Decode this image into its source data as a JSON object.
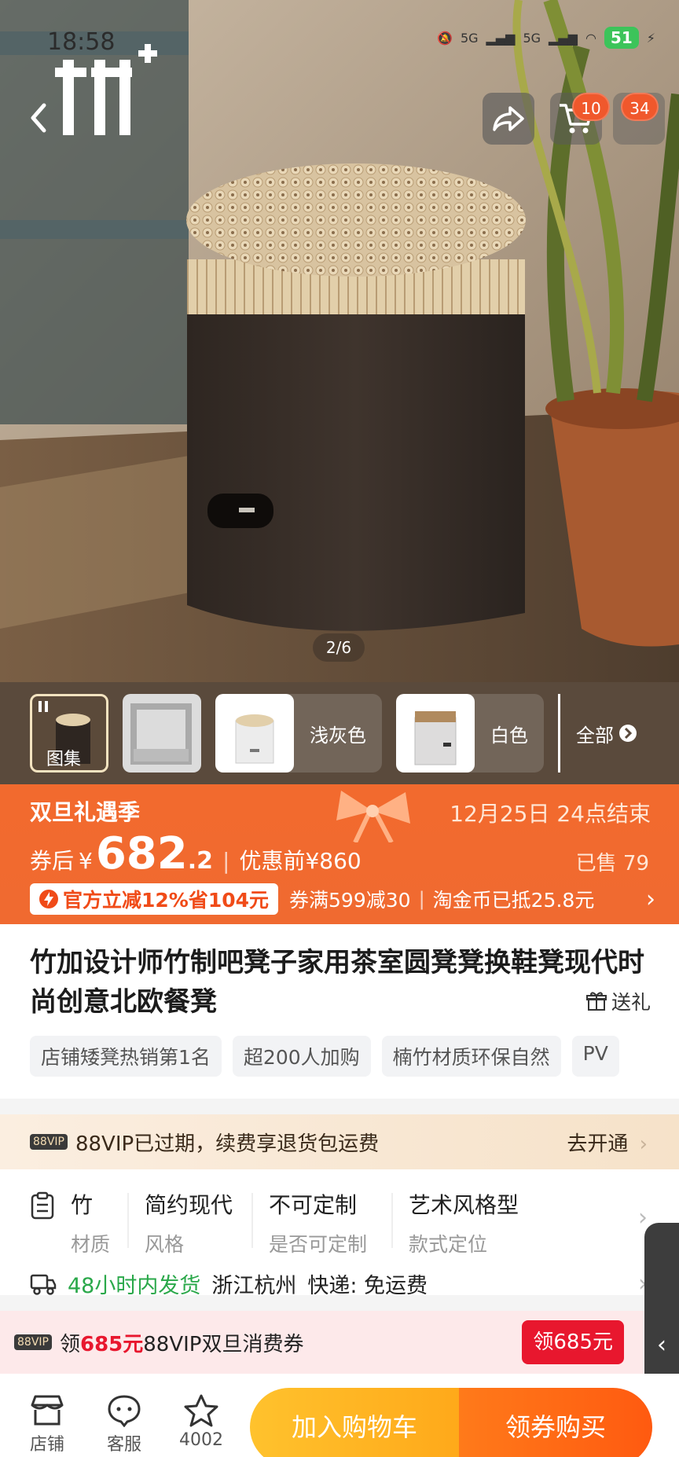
{
  "status_bar": {
    "time": "18:58",
    "network_1": "5G",
    "network_2": "5G",
    "battery": "51"
  },
  "header": {
    "cart_badge": "10",
    "more_badge": "34"
  },
  "hero": {
    "page_indicator": "2/6"
  },
  "thumbnails": {
    "gallery_label": "图集",
    "color_1": "浅灰色",
    "color_2": "白色",
    "all_label": "全部"
  },
  "promo": {
    "event_title": "双旦礼遇季",
    "end_time": "12月25日 24点结束",
    "price_prefix": "券后",
    "currency": "¥",
    "price_main": "682",
    "price_decimal": ".2",
    "price_before": "优惠前¥860",
    "sold": "已售 79",
    "official_discount": "官方立减12%省104元",
    "coupon_rule": "券满599减30",
    "coin_info": "淘金币已抵25.8元"
  },
  "product": {
    "title": "竹加设计师竹制吧凳子家用茶室圆凳凳换鞋凳现代时尚创意北欧餐凳",
    "gift_label": "送礼",
    "tags": [
      "店铺矮凳热销第1名",
      "超200人加购",
      "楠竹材质环保自然",
      "PV"
    ]
  },
  "vip": {
    "badge": "88VIP",
    "text": "88VIP已过期，续费享退货包运费",
    "action": "去开通"
  },
  "attributes": [
    {
      "value": "竹",
      "key": "材质"
    },
    {
      "value": "简约现代",
      "key": "风格"
    },
    {
      "value": "不可定制",
      "key": "是否可定制"
    },
    {
      "value": "艺术风格型",
      "key": "款式定位"
    }
  ],
  "shipping": {
    "fast": "48小时内发货",
    "origin": "浙江杭州",
    "express": "快递:  免运费"
  },
  "coupon": {
    "badge": "88VIP",
    "prefix": "领",
    "amount": "685元",
    "suffix": "88VIP双旦消费券",
    "button": "领685元"
  },
  "bottom_bar": {
    "shop": "店铺",
    "service": "客服",
    "favorites": "4002",
    "add_to_cart": "加入购物车",
    "buy": "领券购买"
  },
  "colors": {
    "promo_orange": "#f26a2e",
    "cta_yellow": "#ffb423",
    "cta_orange": "#ff6a14",
    "red": "#e8172e",
    "green": "#2aa84a"
  }
}
